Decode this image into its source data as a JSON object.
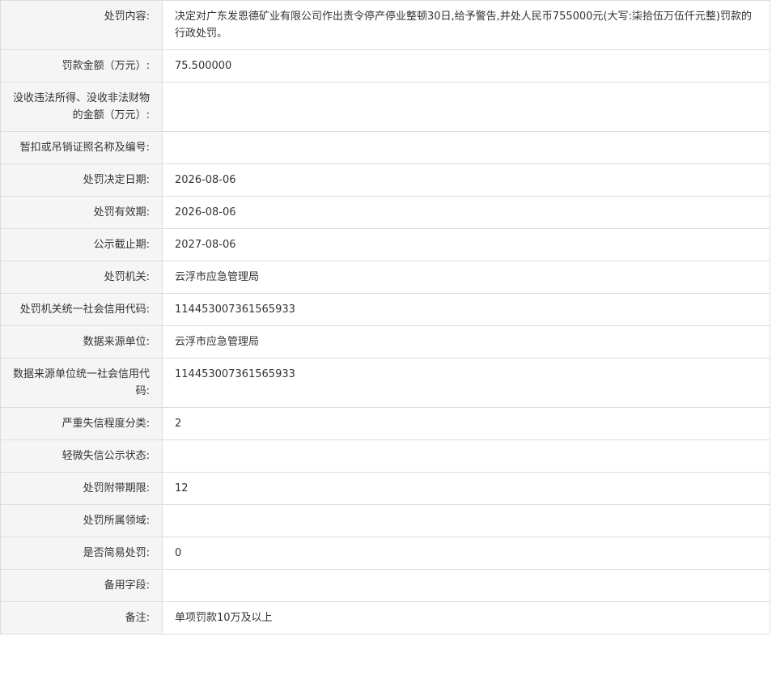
{
  "rows": [
    {
      "label": "处罚内容:",
      "value": "决定对广东发恩德矿业有限公司作出责令停产停业整顿30日,给予警告,并处人民币755000元(大写:柒拾伍万伍仟元整)罚款的行政处罚。"
    },
    {
      "label": "罚款金额（万元）:",
      "value": "75.500000"
    },
    {
      "label": "没收违法所得、没收非法财物的金额（万元）:",
      "value": ""
    },
    {
      "label": "暂扣或吊销证照名称及编号:",
      "value": ""
    },
    {
      "label": "处罚决定日期:",
      "value": "2026-08-06"
    },
    {
      "label": "处罚有效期:",
      "value": "2026-08-06"
    },
    {
      "label": "公示截止期:",
      "value": "2027-08-06"
    },
    {
      "label": "处罚机关:",
      "value": "云浮市应急管理局"
    },
    {
      "label": "处罚机关统一社会信用代码:",
      "value": "114453007361565933"
    },
    {
      "label": "数据来源单位:",
      "value": "云浮市应急管理局"
    },
    {
      "label": "数据来源单位统一社会信用代码:",
      "value": "114453007361565933"
    },
    {
      "label": "严重失信程度分类:",
      "value": "2"
    },
    {
      "label": "轻微失信公示状态:",
      "value": ""
    },
    {
      "label": "处罚附带期限:",
      "value": "12"
    },
    {
      "label": "处罚所属领域:",
      "value": ""
    },
    {
      "label": "是否简易处罚:",
      "value": "0"
    },
    {
      "label": "备用字段:",
      "value": ""
    },
    {
      "label": "备注:",
      "value": "单项罚款10万及以上"
    }
  ]
}
